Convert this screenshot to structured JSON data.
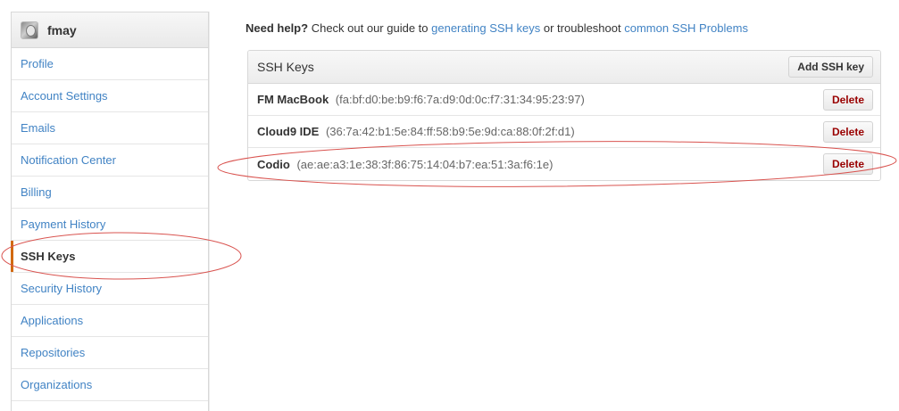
{
  "sidebar": {
    "username": "fmay",
    "items": [
      {
        "label": "Profile"
      },
      {
        "label": "Account Settings"
      },
      {
        "label": "Emails"
      },
      {
        "label": "Notification Center"
      },
      {
        "label": "Billing"
      },
      {
        "label": "Payment History"
      },
      {
        "label": "SSH Keys",
        "selected": true
      },
      {
        "label": "Security History"
      },
      {
        "label": "Applications"
      },
      {
        "label": "Repositories"
      },
      {
        "label": "Organizations"
      }
    ]
  },
  "help": {
    "lead": "Need help?",
    "text1": "Check out our guide to",
    "link1": "generating SSH keys",
    "text2": "or troubleshoot",
    "link2": "common SSH Problems"
  },
  "keys": {
    "title": "SSH Keys",
    "add_label": "Add SSH key",
    "delete_label": "Delete",
    "items": [
      {
        "name": "FM MacBook",
        "fingerprint": "(fa:bf:d0:be:b9:f6:7a:d9:0d:0c:f7:31:34:95:23:97)"
      },
      {
        "name": "Cloud9 IDE",
        "fingerprint": "(36:7a:42:b1:5e:84:ff:58:b9:5e:9d:ca:88:0f:2f:d1)"
      },
      {
        "name": "Codio",
        "fingerprint": "(ae:ae:a3:1e:38:3f:86:75:14:04:b7:ea:51:3a:f6:1e)"
      }
    ]
  },
  "colors": {
    "link": "#4183c4",
    "selected_marker": "#d26911",
    "delete_text": "#990000",
    "annotation": "#d9534f"
  }
}
